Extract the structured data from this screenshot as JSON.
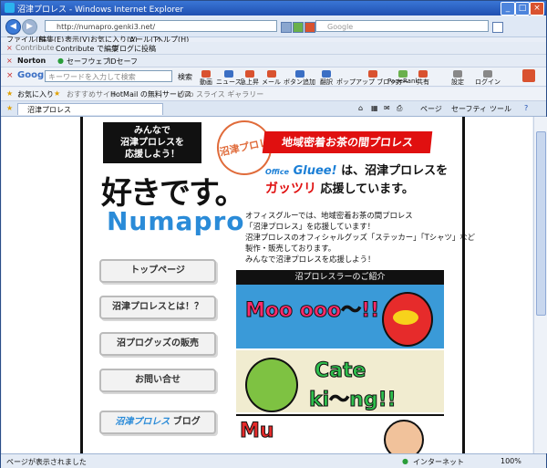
{
  "window": {
    "title": "沼津プロレス - Windows Internet Explorer"
  },
  "address": {
    "url": "http://numapro.genki3.net/",
    "search_placeholder": "Google"
  },
  "menu": [
    "ファイル(F)",
    "編集(E)",
    "表示(V)",
    "お気に入り(A)",
    "ツール(T)",
    "ヘルプ(H)"
  ],
  "contribute_bar": {
    "contribute": "Contribute",
    "edit": "Contribute で編集",
    "post": "ブログに投稿"
  },
  "norton_bar": {
    "norton": "Norton",
    "safeweb": "セーフウェブ",
    "idsafe": "IDセーフ"
  },
  "google_bar": {
    "brand": "Google",
    "placeholder": "キーワードを入力して検索",
    "search": "検索",
    "items": [
      "動画",
      "ニュース",
      "急上昇",
      "メール",
      "ボタン追加",
      "翻訳",
      "ポップアップ ブロッカー",
      "PageRank",
      "共有",
      "設定",
      "ログイン"
    ]
  },
  "favorites_bar": {
    "favorites": "お気に入り",
    "suggested": "おすすめサイト",
    "hotmail": "HotMail の無料サービス",
    "webslice": "Web スライス ギャラリー"
  },
  "tab": {
    "label": "沼津プロレス"
  },
  "command_bar": {
    "page": "ページ",
    "safety": "セーフティ",
    "tools": "ツール"
  },
  "status": {
    "text": "ページが表示されました",
    "zone": "インターネット",
    "zoom": "100%"
  },
  "site": {
    "support_box": [
      "みんなで",
      "沼津プロレスを",
      "応援しよう！"
    ],
    "stamp": "沼津プロレ",
    "banner": "地域密着お茶の間プロレス",
    "suki": "好きです。",
    "logo": "Numapro",
    "brand_office": "Office",
    "brand_name": "Gluee!",
    "brand_line1_rest": "は、沼津プロレスを",
    "brand_gattsuri": "ガッツリ",
    "brand_line2_rest": "応援しています。",
    "description": [
      "オフィスグルーでは、地域密着お茶の間プロレス",
      "「沼津プロレス」を応援しています！",
      "沼津プロレスのオフィシャルグッズ「ステッカー」「Tシャツ」など",
      "製作・販売しております。",
      "みんなで沼津プロレスを応援しよう！"
    ],
    "nav": [
      "トップページ",
      "沼津プロレスとは！？",
      "沼プログッズの販売",
      "お問い合せ"
    ],
    "blog_name": "沼津プロレス",
    "blog_label": "ブログ",
    "intro_header": "沼プロレスラーのご紹介",
    "wrestler1": "Moo ooo〜!!",
    "wrestler2_a": "Cate",
    "wrestler2_b": "ki〜ng!!",
    "wrestler3": "Mu"
  }
}
